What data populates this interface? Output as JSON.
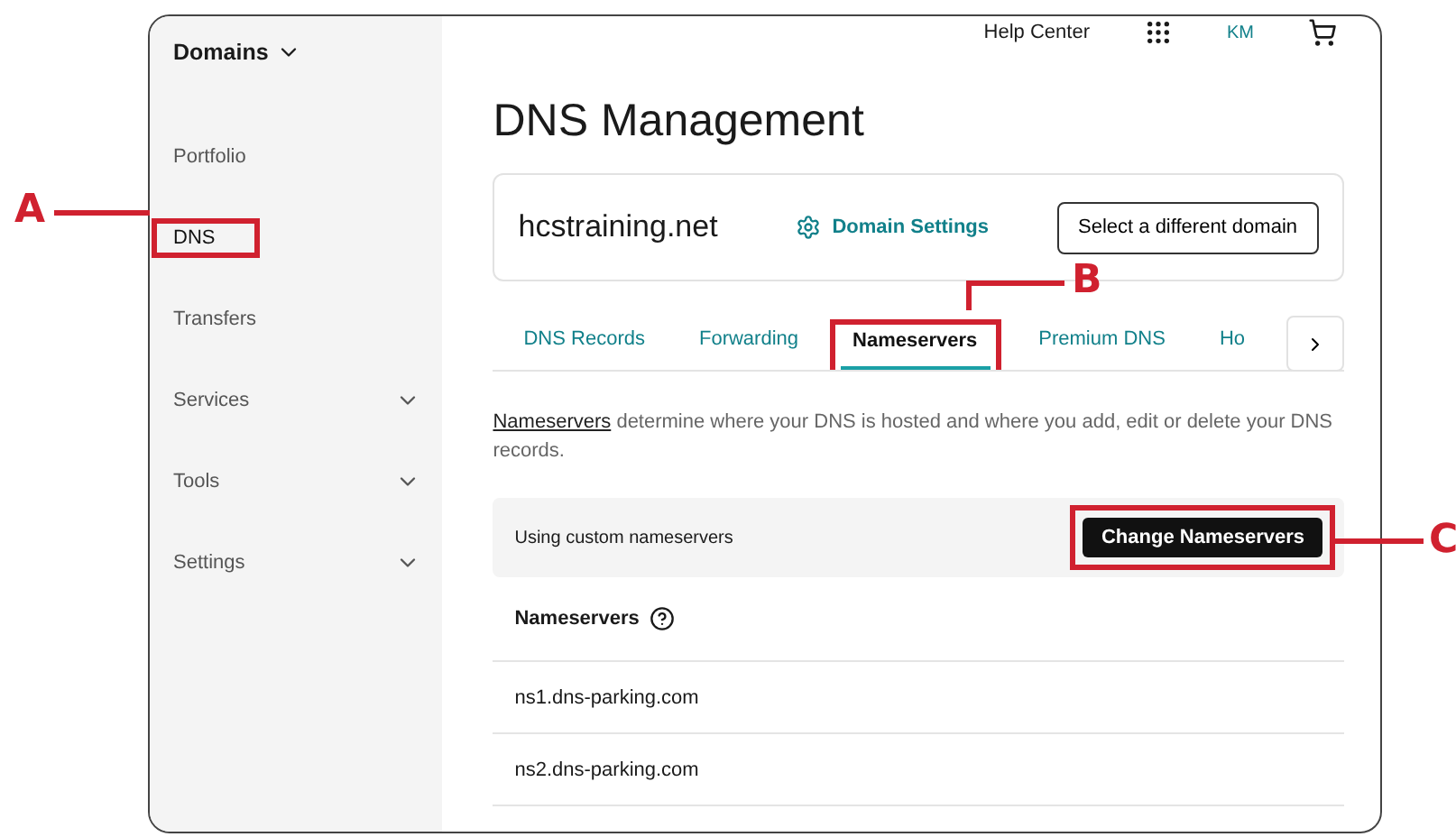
{
  "sidebar": {
    "header": "Domains",
    "items": [
      {
        "label": "Portfolio",
        "selected": false,
        "expandable": false,
        "highlighted": false
      },
      {
        "label": "DNS",
        "selected": true,
        "expandable": false,
        "highlighted": true
      },
      {
        "label": "Transfers",
        "selected": false,
        "expandable": false,
        "highlighted": false
      },
      {
        "label": "Services",
        "selected": false,
        "expandable": true,
        "highlighted": false
      },
      {
        "label": "Tools",
        "selected": false,
        "expandable": true,
        "highlighted": false
      },
      {
        "label": "Settings",
        "selected": false,
        "expandable": true,
        "highlighted": false
      }
    ]
  },
  "topbar": {
    "help": "Help Center",
    "avatar": "KM"
  },
  "title": "DNS Management",
  "domain_card": {
    "domain": "hcstraining.net",
    "settings_link": "Domain Settings",
    "button": "Select a different domain"
  },
  "tabs": [
    {
      "label": "DNS Records",
      "selected": false,
      "highlighted": false
    },
    {
      "label": "Forwarding",
      "selected": false,
      "highlighted": false
    },
    {
      "label": "Nameservers",
      "selected": true,
      "highlighted": true
    },
    {
      "label": "Premium DNS",
      "selected": false,
      "highlighted": false
    },
    {
      "label": "Ho",
      "selected": false,
      "highlighted": false
    }
  ],
  "description": {
    "link": "Nameservers",
    "text": " determine where your DNS is hosted and where you add, edit or delete your DNS records."
  },
  "status_bar": {
    "text": "Using custom nameservers",
    "button": "Change Nameservers",
    "highlighted": true
  },
  "nameservers": {
    "header": "Nameservers",
    "rows": [
      "ns1.dns-parking.com",
      "ns2.dns-parking.com"
    ]
  },
  "callouts": [
    {
      "label": "A"
    },
    {
      "label": "B"
    },
    {
      "label": "C"
    }
  ]
}
